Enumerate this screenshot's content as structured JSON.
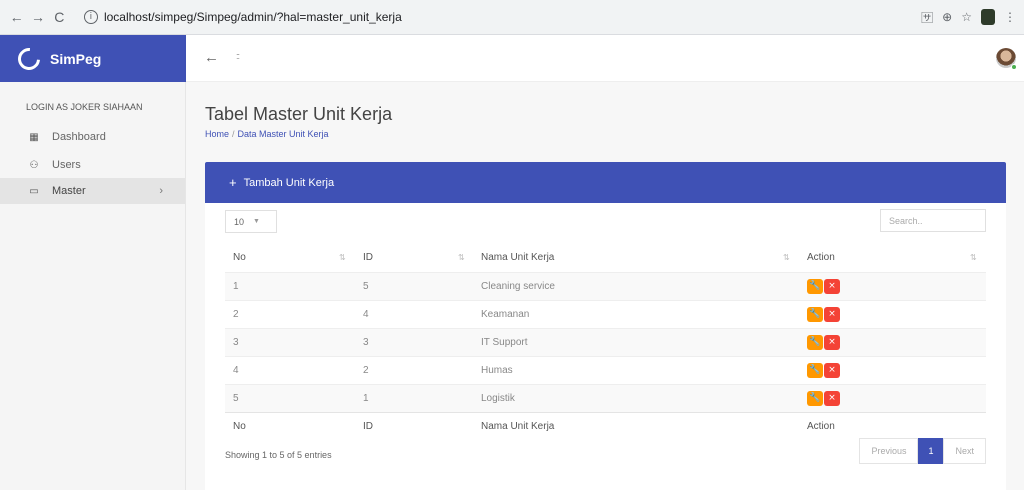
{
  "browser": {
    "url": "localhost/simpeg/Simpeg/admin/?hal=master_unit_kerja",
    "info_glyph": "i",
    "back_glyph": "←",
    "forward_glyph": "→",
    "reload_glyph": "C",
    "translate_glyph": "🈂",
    "zoom_glyph": "⊕",
    "star_glyph": "☆",
    "menu_glyph": "⋮"
  },
  "brand": {
    "name": "SimPeg",
    "color": "#3f51b5"
  },
  "sidebar": {
    "login_as": "LOGIN AS JOKER SIAHAAN",
    "items": [
      {
        "label": "Dashboard",
        "icon": "dashboard-icon",
        "glyph": "▦"
      },
      {
        "label": "Users",
        "icon": "users-icon",
        "glyph": "⚇"
      },
      {
        "label": "Master",
        "icon": "folder-icon",
        "glyph": "▭",
        "active": true,
        "chevron": "›"
      }
    ]
  },
  "topbar": {
    "back_glyph": "←",
    "grid_glyph": "::"
  },
  "page": {
    "title": "Tabel Master Unit Kerja",
    "breadcrumb": {
      "home": "Home",
      "separator": "/",
      "current": "Data Master Unit Kerja"
    }
  },
  "card": {
    "add_label": "Tambah Unit Kerja",
    "add_glyph": "+",
    "page_length": "10",
    "search_placeholder": "Search..",
    "columns": [
      "No",
      "ID",
      "Nama Unit Kerja",
      "Action"
    ],
    "rows": [
      {
        "no": "1",
        "id": "5",
        "name": "Cleaning service"
      },
      {
        "no": "2",
        "id": "4",
        "name": "Keamanan"
      },
      {
        "no": "3",
        "id": "3",
        "name": "IT Support"
      },
      {
        "no": "4",
        "id": "2",
        "name": "Humas"
      },
      {
        "no": "5",
        "id": "1",
        "name": "Logistik"
      }
    ],
    "edit_glyph": "🔧",
    "delete_glyph": "×",
    "info": "Showing 1 to 5 of 5 entries",
    "pagination": {
      "previous": "Previous",
      "current": "1",
      "next": "Next"
    }
  }
}
